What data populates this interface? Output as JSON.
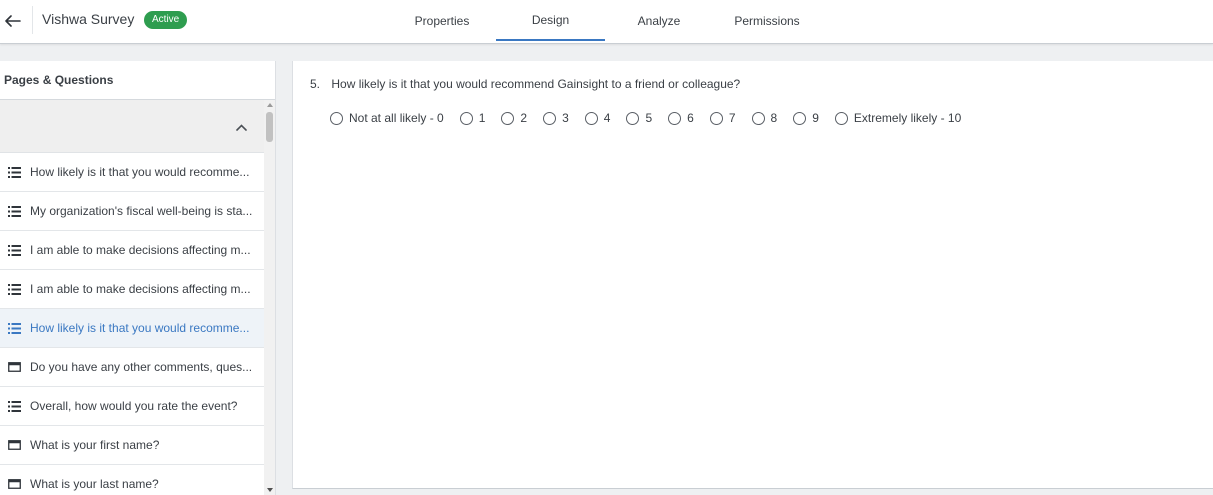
{
  "header": {
    "title": "Vishwa Survey",
    "status": "Active",
    "tabs": [
      {
        "label": "Properties"
      },
      {
        "label": "Design"
      },
      {
        "label": "Analyze"
      },
      {
        "label": "Permissions"
      }
    ]
  },
  "sidebar": {
    "heading": "Pages & Questions",
    "questions": [
      {
        "label": "How likely is it that you would recomme...",
        "icon": "list-icon"
      },
      {
        "label": "My organization's fiscal well-being is sta...",
        "icon": "list-icon"
      },
      {
        "label": "I am able to make decisions affecting m...",
        "icon": "list-icon"
      },
      {
        "label": "I am able to make decisions affecting m...",
        "icon": "list-icon"
      },
      {
        "label": "How likely is it that you would recomme...",
        "icon": "list-icon"
      },
      {
        "label": "Do you have any other comments, ques...",
        "icon": "text-box-icon"
      },
      {
        "label": "Overall, how would you rate the event?",
        "icon": "list-icon"
      },
      {
        "label": "What is your first name?",
        "icon": "text-box-icon"
      },
      {
        "label": "What is your last name?",
        "icon": "text-box-icon"
      }
    ]
  },
  "main": {
    "question_number": "5.",
    "question_text": "How likely is it that you would recommend Gainsight to a friend or colleague?",
    "options": [
      "Not at all likely - 0",
      "1",
      "2",
      "3",
      "4",
      "5",
      "6",
      "7",
      "8",
      "9",
      "Extremely likely - 10"
    ]
  },
  "colors": {
    "accent": "#3a78c2",
    "active_badge": "#2e9d4f"
  }
}
